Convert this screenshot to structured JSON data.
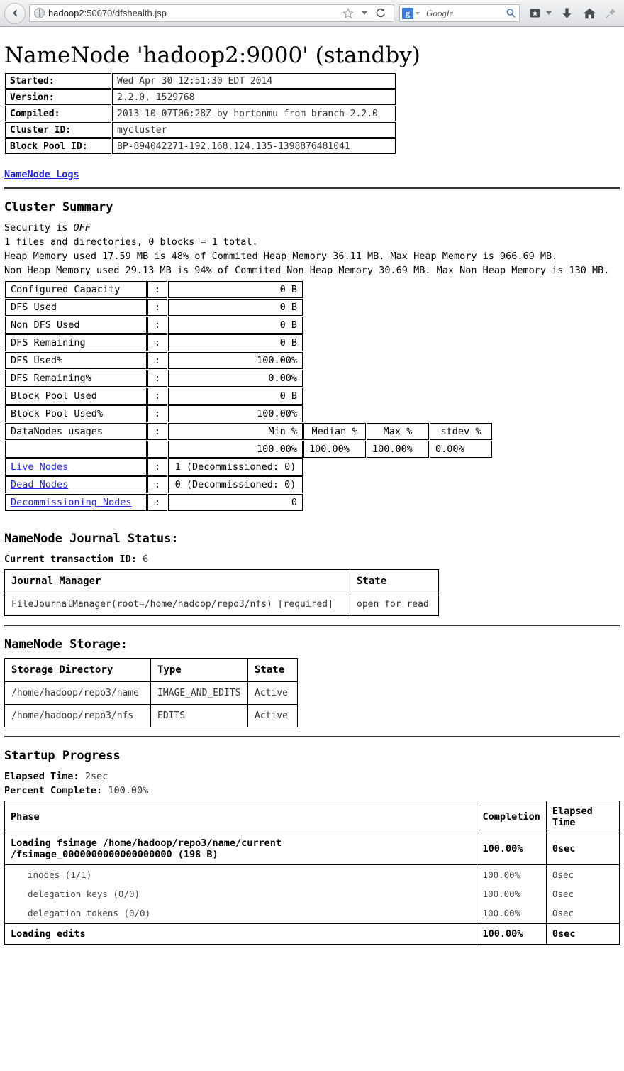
{
  "browser": {
    "back_icon": "back-arrow-icon",
    "favicon": "globe-favicon-icon",
    "url_host": "hadoop2",
    "url_rest": ":50070/dfshealth.jsp",
    "url_full": "hadoop2:50070/dfshealth.jsp",
    "bookmark_star_icon": "star-icon",
    "bookmark_caret_icon": "chevron-down-icon",
    "reload_icon": "reload-icon",
    "search_engine_logo": "g",
    "search_placeholder": "Google",
    "search_magnifier_icon": "magnifier-icon",
    "bookmarks_icon": "bookmarks-star-box-icon",
    "bookmarks_caret_icon": "chevron-down-icon",
    "downloads_icon": "download-arrow-icon",
    "home_icon": "home-icon",
    "pin_icon": "pin-icon"
  },
  "page": {
    "title": "NameNode 'hadoop2:9000' (standby)",
    "logs_link": "NameNode Logs"
  },
  "info": {
    "rows": [
      {
        "key": "Started:",
        "value": "Wed Apr 30 12:51:30 EDT 2014"
      },
      {
        "key": "Version:",
        "value": "2.2.0, 1529768"
      },
      {
        "key": "Compiled:",
        "value": "2013-10-07T06:28Z by hortonmu from branch-2.2.0"
      },
      {
        "key": "Cluster ID:",
        "value": "mycluster"
      },
      {
        "key": "Block Pool ID:",
        "value": "BP-894042271-192.168.124.135-1398876481041"
      }
    ]
  },
  "cluster_summary": {
    "heading": "Cluster Summary",
    "security_prefix": "Security is ",
    "security_value": "OFF",
    "files_line": "1 files and directories, 0 blocks = 1 total.",
    "heap_line": "Heap Memory used 17.59 MB is 48% of Commited Heap Memory 36.11 MB. Max Heap Memory is 966.69 MB.",
    "nonheap_line": "Non Heap Memory used 29.13 MB is 94% of Commited Non Heap Memory 30.69 MB. Max Non Heap Memory is 130 MB.",
    "colon": ":",
    "rows": [
      {
        "label": "Configured Capacity",
        "value": "0 B"
      },
      {
        "label": "DFS Used",
        "value": "0 B"
      },
      {
        "label": "Non DFS Used",
        "value": "0 B"
      },
      {
        "label": "DFS Remaining",
        "value": "0 B"
      },
      {
        "label": "DFS Used%",
        "value": "100.00%"
      },
      {
        "label": "DFS Remaining%",
        "value": "0.00%"
      },
      {
        "label": "Block Pool Used",
        "value": "0 B"
      },
      {
        "label": "Block Pool Used%",
        "value": "100.00%"
      }
    ],
    "datanodes_usages": {
      "label": "DataNodes usages",
      "headers": {
        "min": "Min %",
        "median": "Median %",
        "max": "Max %",
        "stdev": "stdev %"
      },
      "values": {
        "min": "100.00%",
        "median": "100.00%",
        "max": "100.00%",
        "stdev": "0.00%"
      }
    },
    "node_rows": [
      {
        "label": "Live Nodes",
        "value": "1 (Decommissioned: 0)"
      },
      {
        "label": "Dead Nodes",
        "value": "0 (Decommissioned: 0)"
      },
      {
        "label": "Decommissioning Nodes",
        "value": "0"
      }
    ]
  },
  "journal": {
    "heading": "NameNode Journal Status:",
    "txid_label": "Current transaction ID:",
    "txid_value": "6",
    "headers": {
      "manager": "Journal Manager",
      "state": "State"
    },
    "rows": [
      {
        "manager": "FileJournalManager(root=/home/hadoop/repo3/nfs) [required]",
        "state": "open for read"
      }
    ]
  },
  "storage": {
    "heading": "NameNode Storage:",
    "headers": {
      "directory": "Storage Directory",
      "type": "Type",
      "state": "State"
    },
    "rows": [
      {
        "directory": "/home/hadoop/repo3/name",
        "type": "IMAGE_AND_EDITS",
        "state": "Active"
      },
      {
        "directory": "/home/hadoop/repo3/nfs",
        "type": "EDITS",
        "state": "Active"
      }
    ]
  },
  "startup": {
    "heading": "Startup Progress",
    "elapsed_label": "Elapsed Time:",
    "elapsed_value": "2sec",
    "percent_label": "Percent Complete:",
    "percent_value": "100.00%",
    "headers": {
      "phase": "Phase",
      "completion": "Completion",
      "elapsed": "Elapsed Time"
    },
    "rows": [
      {
        "kind": "main",
        "phase_line1": "Loading fsimage /home/hadoop/repo3/name/current",
        "phase_line2": "/fsimage_0000000000000000000 (198 B)",
        "completion": "100.00%",
        "elapsed": "0sec"
      },
      {
        "kind": "step",
        "phase": "inodes (1/1)",
        "completion": "100.00%",
        "elapsed": "0sec"
      },
      {
        "kind": "step",
        "phase": "delegation keys (0/0)",
        "completion": "100.00%",
        "elapsed": "0sec"
      },
      {
        "kind": "step",
        "phase": "delegation tokens (0/0)",
        "completion": "100.00%",
        "elapsed": "0sec"
      },
      {
        "kind": "last",
        "phase": "Loading edits",
        "completion": "100.00%",
        "elapsed": "0sec"
      }
    ]
  }
}
